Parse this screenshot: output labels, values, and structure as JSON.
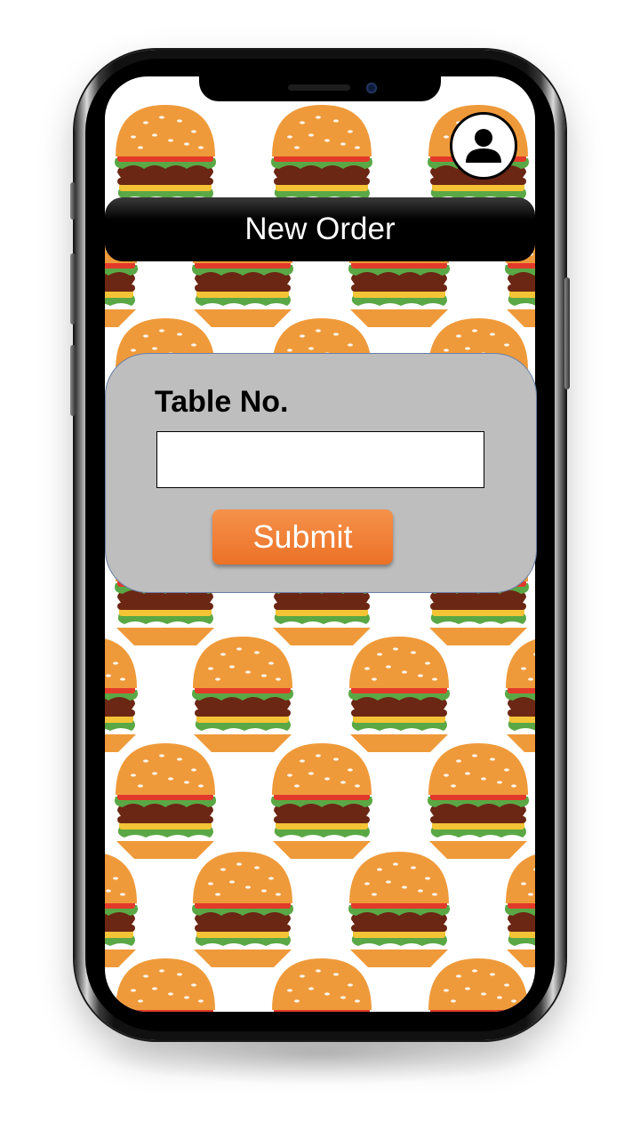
{
  "header": {
    "title": "New Order",
    "profile_icon": "user-icon"
  },
  "form": {
    "table_label": "Table No.",
    "table_value": "",
    "submit_label": "Submit"
  },
  "background": {
    "pattern": "burger-icon"
  },
  "colors": {
    "title_bar": "#000000",
    "card": "#bebebe",
    "submit_top": "#f5924b",
    "submit_bottom": "#ec7126"
  }
}
